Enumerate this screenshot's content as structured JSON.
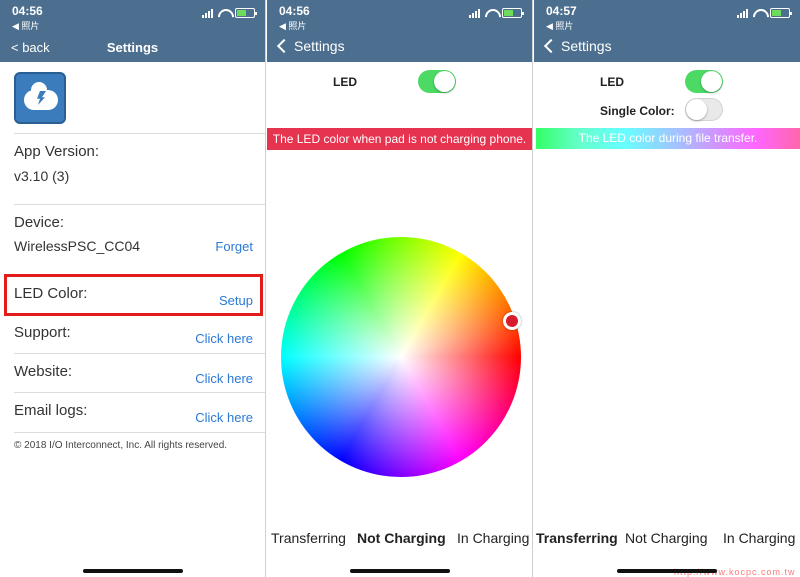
{
  "panels": [
    {
      "status": {
        "time": "04:56",
        "sub": "◀ 照片"
      },
      "nav": {
        "back": "< back",
        "title": "Settings"
      },
      "app_version": {
        "label": "App Version:",
        "value": "v3.10 (3)"
      },
      "device": {
        "label": "Device:",
        "value": "WirelessPSC_CC04",
        "action": "Forget"
      },
      "led_color": {
        "label": "LED Color:",
        "action": "Setup"
      },
      "support": {
        "label": "Support:",
        "action": "Click here"
      },
      "website": {
        "label": "Website:",
        "action": "Click here"
      },
      "email_logs": {
        "label": "Email logs:",
        "action": "Click here"
      },
      "copyright": "© 2018 I/O Interconnect, Inc. All rights reserved."
    },
    {
      "status": {
        "time": "04:56",
        "sub": "◀ 照片"
      },
      "nav": {
        "back": "Settings"
      },
      "led_label": "LED",
      "led_on": true,
      "banner": "The LED color when pad is not charging phone.",
      "picker_color": "#d71d2d",
      "modes": [
        "Transferring",
        "Not Charging",
        "In Charging"
      ],
      "active_mode": "Not Charging"
    },
    {
      "status": {
        "time": "04:57",
        "sub": "◀ 照片"
      },
      "nav": {
        "back": "Settings"
      },
      "led_label": "LED",
      "led_on": true,
      "single_color_label": "Single Color:",
      "single_color_on": false,
      "banner": "The LED color during file transfer.",
      "modes": [
        "Transferring",
        "Not Charging",
        "In Charging"
      ],
      "active_mode": "Transferring"
    }
  ],
  "watermark": "http://www.kocpc.com.tw",
  "colors": {
    "nav_bg": "#4c6f8f",
    "link": "#2a7ad6",
    "toggle_on": "#4cd964",
    "highlight": "#e21b1b",
    "banner_red": "#e6334f"
  }
}
